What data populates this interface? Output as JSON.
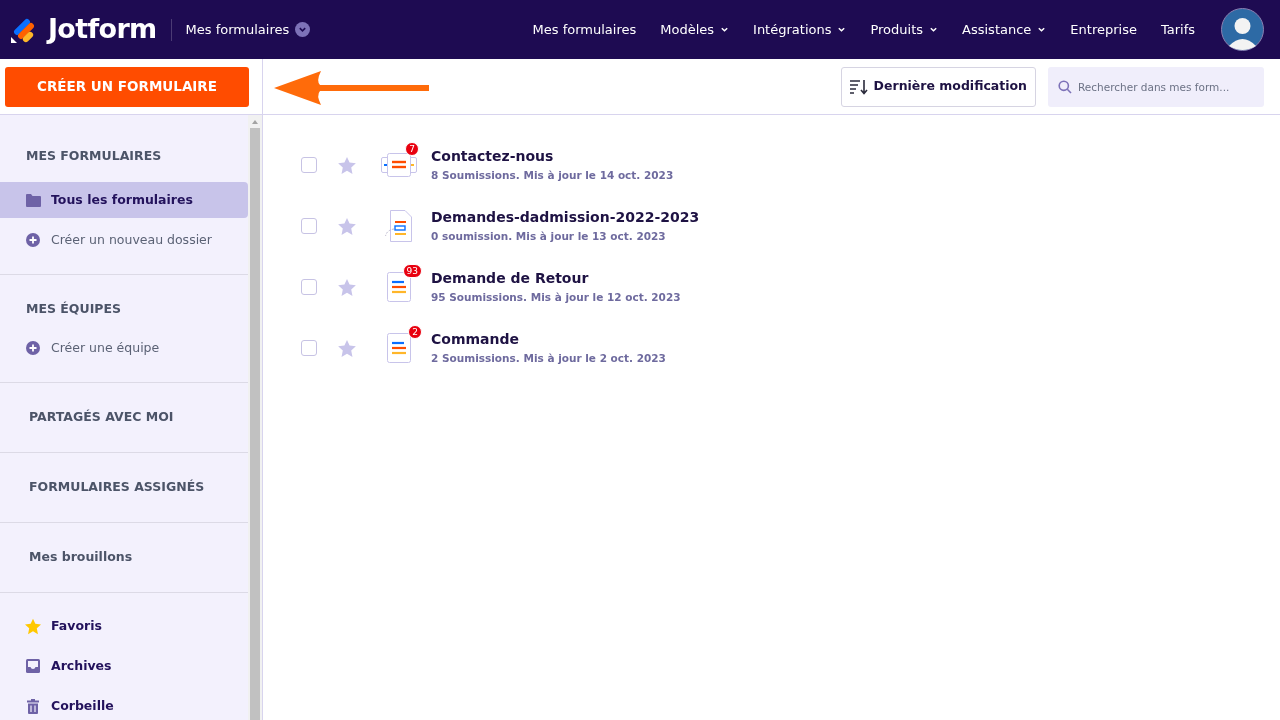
{
  "header": {
    "brand": "Jotform",
    "context_menu": "Mes formulaires",
    "nav": [
      {
        "label": "Mes formulaires",
        "dropdown": false
      },
      {
        "label": "Modèles",
        "dropdown": true
      },
      {
        "label": "Intégrations",
        "dropdown": true
      },
      {
        "label": "Produits",
        "dropdown": true
      },
      {
        "label": "Assistance",
        "dropdown": true
      },
      {
        "label": "Entreprise",
        "dropdown": false
      },
      {
        "label": "Tarifs",
        "dropdown": false
      }
    ]
  },
  "create_button": "CRÉER UN FORMULAIRE",
  "toolbar": {
    "sort_button": "Dernière modification",
    "search": {
      "placeholder": "Rechercher dans mes form..."
    }
  },
  "sidebar": {
    "sections": [
      {
        "heading": "MES FORMULAIRES",
        "items": [
          {
            "label": "Tous les formulaires",
            "kind": "folder",
            "selected": true
          },
          {
            "label": "Créer un nouveau dossier",
            "kind": "plus",
            "selected": false
          }
        ]
      },
      {
        "heading": "MES ÉQUIPES",
        "items": [
          {
            "label": "Créer une équipe",
            "kind": "plus",
            "selected": false
          }
        ]
      },
      {
        "heading": "PARTAGÉS AVEC MOI"
      },
      {
        "heading": "FORMULAIRES ASSIGNÉS"
      },
      {
        "heading": "Mes brouillons"
      },
      {
        "items": [
          {
            "label": "Favoris",
            "kind": "star",
            "selected": false
          },
          {
            "label": "Archives",
            "kind": "inbox",
            "selected": false
          },
          {
            "label": "Corbeille",
            "kind": "trash",
            "selected": false
          }
        ]
      }
    ]
  },
  "forms": [
    {
      "title": "Contactez-nous",
      "meta": "8 Soumissions. Mis à jour le 14 oct. 2023",
      "kind": "card",
      "badge": "7",
      "checked": false,
      "starred": false
    },
    {
      "title": "Demandes-dadmission-2022-2023",
      "meta": "0 soumission. Mis à jour le 13 oct. 2023",
      "kind": "import",
      "checked": false,
      "starred": false
    },
    {
      "title": "Demande de Retour",
      "meta": "95 Soumissions. Mis à jour le 12 oct. 2023",
      "kind": "doc",
      "badge": "93",
      "checked": false,
      "starred": false
    },
    {
      "title": "Commande",
      "meta": "2 Soumissions. Mis à jour le 2 oct. 2023",
      "kind": "doc",
      "badge": "2",
      "checked": false,
      "starred": false
    }
  ]
}
